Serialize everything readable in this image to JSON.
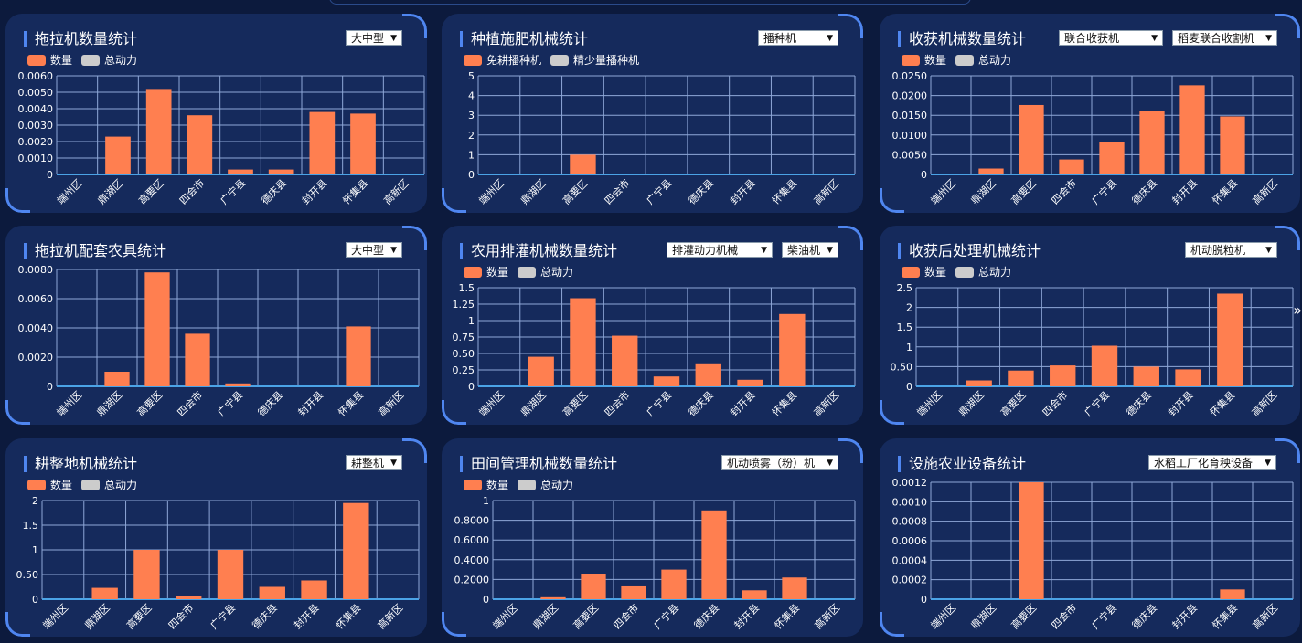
{
  "colors": {
    "count": "#ff7f50",
    "power": "#cccccc",
    "grid": "#8fa8d8",
    "axis": "#4ba3e6",
    "bg": "#152a5c"
  },
  "regions": [
    "端州区",
    "鼎湖区",
    "高要区",
    "四会市",
    "广宁县",
    "德庆县",
    "封开县",
    "怀集县",
    "高新区"
  ],
  "nav": {
    "next_icon": "»"
  },
  "panels": [
    {
      "title": "拖拉机数量统计",
      "selects": [
        "大中型"
      ],
      "legend": [
        "数量",
        "总动力"
      ],
      "chart_data": {
        "type": "bar",
        "categories": [
          "端州区",
          "鼎湖区",
          "高要区",
          "四会市",
          "广宁县",
          "德庆县",
          "封开县",
          "怀集县",
          "高新区"
        ],
        "series": [
          {
            "name": "数量",
            "values": [
              0,
              0.0023,
              0.0052,
              0.0036,
              0.0003,
              0.0003,
              0.0038,
              0.0037,
              0
            ]
          }
        ],
        "yticks": [
          "0",
          "0.0010",
          "0.0020",
          "0.0030",
          "0.0040",
          "0.0050",
          "0.0060"
        ],
        "ylim": [
          0,
          0.006
        ]
      }
    },
    {
      "title": "种植施肥机械统计",
      "selects": [
        "播种机"
      ],
      "legend": [
        "免耕播种机",
        "精少量播种机"
      ],
      "chart_data": {
        "type": "bar",
        "categories": [
          "端州区",
          "鼎湖区",
          "高要区",
          "四会市",
          "广宁县",
          "德庆县",
          "封开县",
          "怀集县",
          "高新区"
        ],
        "series": [
          {
            "name": "免耕播种机",
            "values": [
              0,
              0,
              1,
              0,
              0,
              0,
              0,
              0,
              0
            ]
          }
        ],
        "yticks": [
          "0",
          "1",
          "2",
          "3",
          "4",
          "5"
        ],
        "ylim": [
          0,
          5
        ]
      }
    },
    {
      "title": "收获机械数量统计",
      "selects": [
        "联合收获机",
        "稻麦联合收割机"
      ],
      "legend": [
        "数量",
        "总动力"
      ],
      "chart_data": {
        "type": "bar",
        "categories": [
          "端州区",
          "鼎湖区",
          "高要区",
          "四会市",
          "广宁县",
          "德庆县",
          "封开县",
          "怀集县",
          "高新区"
        ],
        "series": [
          {
            "name": "数量",
            "values": [
              0,
              0.0015,
              0.0176,
              0.0038,
              0.0082,
              0.016,
              0.0226,
              0.0147,
              0
            ]
          }
        ],
        "yticks": [
          "0",
          "0.0050",
          "0.0100",
          "0.0150",
          "0.0200",
          "0.0250"
        ],
        "ylim": [
          0,
          0.025
        ]
      }
    },
    {
      "title": "拖拉机配套农具统计",
      "selects": [
        "大中型"
      ],
      "legend": [],
      "chart_data": {
        "type": "bar",
        "categories": [
          "端州区",
          "鼎湖区",
          "高要区",
          "四会市",
          "广宁县",
          "德庆县",
          "封开县",
          "怀集县",
          "高新区"
        ],
        "series": [
          {
            "values": [
              0,
              0.001,
              0.0078,
              0.0036,
              0.0002,
              0,
              0,
              0.0041,
              0
            ]
          }
        ],
        "yticks": [
          "0",
          "0.0020",
          "0.0040",
          "0.0060",
          "0.0080"
        ],
        "ylim": [
          0,
          0.008
        ]
      }
    },
    {
      "title": "农用排灌机械数量统计",
      "selects": [
        "排灌动力机械",
        "柴油机"
      ],
      "legend": [
        "数量",
        "总动力"
      ],
      "chart_data": {
        "type": "bar",
        "categories": [
          "端州区",
          "鼎湖区",
          "高要区",
          "四会市",
          "广宁县",
          "德庆县",
          "封开县",
          "怀集县",
          "高新区"
        ],
        "series": [
          {
            "name": "数量",
            "values": [
              0,
              0.45,
              1.34,
              0.77,
              0.15,
              0.35,
              0.1,
              1.1,
              0
            ]
          }
        ],
        "yticks": [
          "0",
          "0.25",
          "0.50",
          "0.75",
          "1",
          "1.25",
          "1.5"
        ],
        "ylim": [
          0,
          1.5
        ]
      }
    },
    {
      "title": "收获后处理机械统计",
      "selects": [
        "机动脱粒机"
      ],
      "legend": [
        "数量",
        "总动力"
      ],
      "chart_data": {
        "type": "bar",
        "categories": [
          "端州区",
          "鼎湖区",
          "高要区",
          "四会市",
          "广宁县",
          "德庆县",
          "封开县",
          "怀集县",
          "高新区"
        ],
        "series": [
          {
            "name": "数量",
            "values": [
              0,
              0.15,
              0.4,
              0.53,
              1.03,
              0.5,
              0.43,
              2.35,
              0
            ]
          }
        ],
        "yticks": [
          "0",
          "0.50",
          "1",
          "1.5",
          "2",
          "2.5"
        ],
        "ylim": [
          0,
          2.5
        ]
      }
    },
    {
      "title": "耕整地机械统计",
      "selects": [
        "耕整机"
      ],
      "legend": [
        "数量",
        "总动力"
      ],
      "chart_data": {
        "type": "bar",
        "categories": [
          "端州区",
          "鼎湖区",
          "高要区",
          "四会市",
          "广宁县",
          "德庆县",
          "封开县",
          "怀集县",
          "高新区"
        ],
        "series": [
          {
            "name": "数量",
            "values": [
              0,
              0.23,
              1,
              0.07,
              1,
              0.25,
              0.38,
              1.95,
              0
            ]
          }
        ],
        "yticks": [
          "0",
          "0.50",
          "1",
          "1.5",
          "2"
        ],
        "ylim": [
          0,
          2
        ]
      }
    },
    {
      "title": "田间管理机械数量统计",
      "selects": [
        "机动喷雾（粉）机"
      ],
      "legend": [
        "数量",
        "总动力"
      ],
      "chart_data": {
        "type": "bar",
        "categories": [
          "端州区",
          "鼎湖区",
          "高要区",
          "四会市",
          "广宁县",
          "德庆县",
          "封开县",
          "怀集县",
          "高新区"
        ],
        "series": [
          {
            "name": "数量",
            "values": [
              0,
              0.02,
              0.25,
              0.13,
              0.3,
              0.9,
              0.09,
              0.22,
              0
            ]
          }
        ],
        "yticks": [
          "0",
          "0.2000",
          "0.4000",
          "0.6000",
          "0.8000",
          "1"
        ],
        "ylim": [
          0,
          1
        ]
      }
    },
    {
      "title": "设施农业设备统计",
      "selects": [
        "水稻工厂化育秧设备"
      ],
      "legend": [],
      "chart_data": {
        "type": "bar",
        "categories": [
          "端州区",
          "鼎湖区",
          "高要区",
          "四会市",
          "广宁县",
          "德庆县",
          "封开县",
          "怀集县",
          "高新区"
        ],
        "series": [
          {
            "values": [
              0,
              0,
              0.0012,
              0,
              0,
              0,
              0,
              0.0001,
              0
            ]
          }
        ],
        "yticks": [
          "0",
          "0.0002",
          "0.0004",
          "0.0006",
          "0.0008",
          "0.0010",
          "0.0012"
        ],
        "ylim": [
          0,
          0.0012
        ]
      }
    }
  ]
}
